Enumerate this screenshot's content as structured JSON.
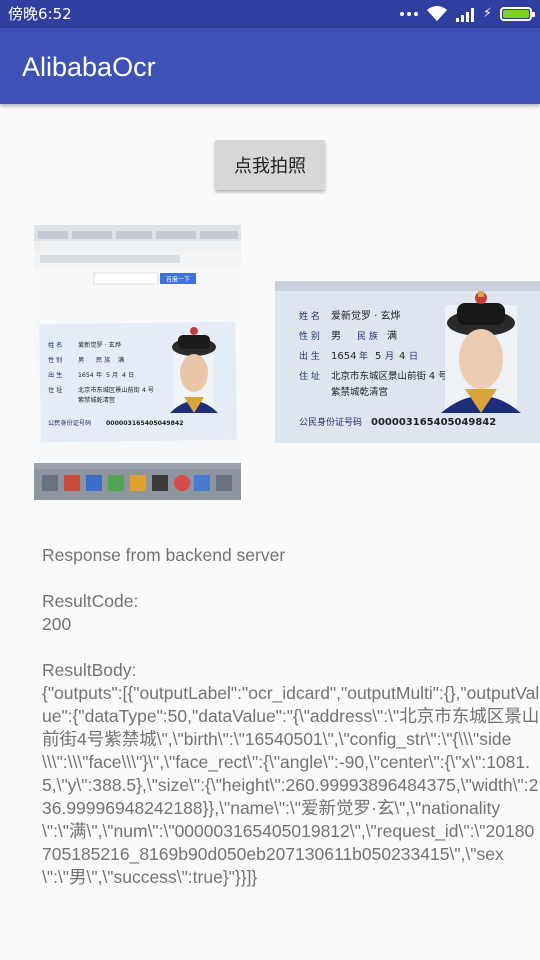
{
  "status_bar": {
    "time": "傍晚6:52",
    "battery_color": "#7ed321"
  },
  "app_bar": {
    "title": "AlibabaOcr",
    "color": "#3f51b5"
  },
  "take_photo_button": {
    "label": "点我拍照"
  },
  "id_card": {
    "name_label": "姓 名",
    "name_value": "爱新觉罗 · 玄烨",
    "sex_label": "性 别",
    "sex_value": "男",
    "ethnicity_label": "民 族",
    "ethnicity_value": "满",
    "birth_label": "出 生",
    "birth_year": "1654",
    "birth_year_unit": "年",
    "birth_month": "5",
    "birth_month_unit": "月",
    "birth_day": "4",
    "birth_day_unit": "日",
    "address_label": "住 址",
    "address_line1": "北京市东城区景山前街 4 号",
    "address_line2": "紫禁城乾清宫",
    "id_label": "公民身份证号码",
    "id_number": "000003165405049842"
  },
  "browser_screen": {
    "search_button": "百度一下"
  },
  "response": {
    "heading": "Response from backend server",
    "result_code_label": "ResultCode:",
    "result_code": "200",
    "result_body_label": "ResultBody:",
    "result_body": "{\"outputs\":[{\"outputLabel\":\"ocr_idcard\",\"outputMulti\":{},\"outputValue\":{\"dataType\":50,\"dataValue\":\"{\\\"address\\\":\\\"北京市东城区景山前街4号紫禁城\\\",\\\"birth\\\":\\\"16540501\\\",\\\"config_str\\\":\\\"{\\\\\\\"side\\\\\\\":\\\\\\\"face\\\\\\\"}\\\",\\\"face_rect\\\":{\\\"angle\\\":-90,\\\"center\\\":{\\\"x\\\":1081.5,\\\"y\\\":388.5},\\\"size\\\":{\\\"height\\\":260.99993896484375,\\\"width\\\":236.99996948242188}},\\\"name\\\":\\\"爱新觉罗·玄\\\",\\\"nationality\\\":\\\"满\\\",\\\"num\\\":\\\"000003165405019812\\\",\\\"request_id\\\":\\\"20180705185216_8169b90d050eb207130611b050233415\\\",\\\"sex\\\":\\\"男\\\",\\\"success\\\":true}\"}}]}"
  }
}
